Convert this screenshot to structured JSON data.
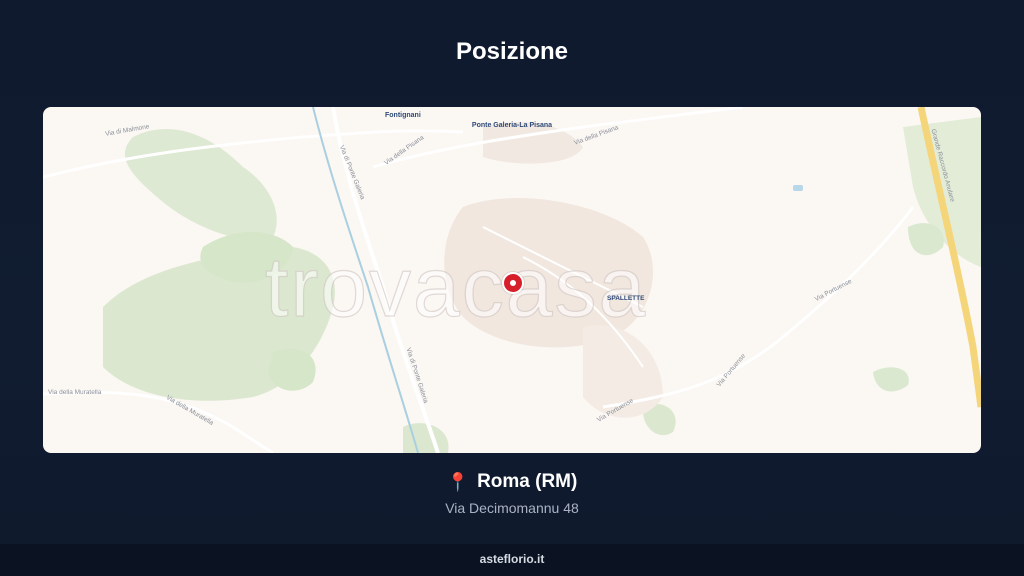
{
  "header": {
    "title": "Posizione"
  },
  "map": {
    "watermark": "trovacasa",
    "place_labels": {
      "fontignani": "Fontignani",
      "ponte_galeria": "Ponte Galeria-La Pisana",
      "spallette": "SPALLETTE"
    },
    "road_labels": {
      "via_malmone": "Via di Malmone",
      "via_pisana_1": "Via della Pisana",
      "via_pisana_2": "Via della Pisana",
      "via_ponte_galeria_1": "Via di Ponte Galeria",
      "via_ponte_galeria_2": "Via di Ponte Galeria",
      "via_muratella_1": "Via della Muratella",
      "via_muratella_2": "Via della Muratella",
      "via_portuense_1": "Via Portuense",
      "via_portuense_2": "Via Portuense",
      "via_portuense_3": "Via Portuense",
      "grande_raccordo": "Grande Raccordo Anulare"
    },
    "marker_icon": "map-pin-icon"
  },
  "location": {
    "icon": "location-pin-icon",
    "city": "Roma (RM)",
    "address": "Via Decimomannu 48"
  },
  "footer": {
    "site": "asteflorio.it"
  },
  "colors": {
    "background": "#0f1a2e",
    "map_bg": "#fbf7f3",
    "green_area": "#d9e8cf",
    "highway": "#f5d57a",
    "marker": "#d61f2b"
  }
}
